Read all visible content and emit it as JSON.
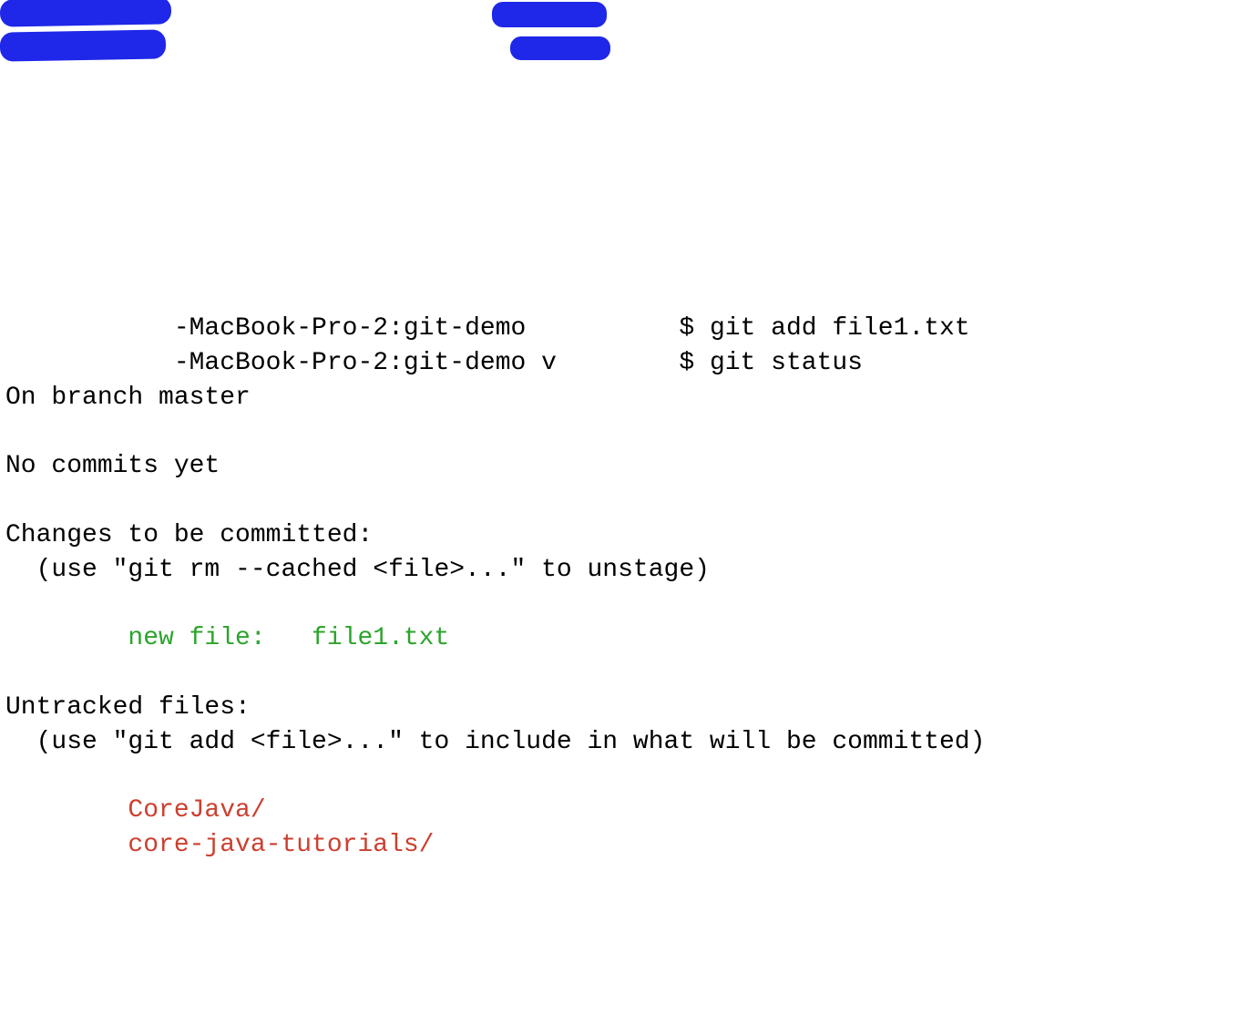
{
  "terminal": {
    "line1": {
      "prompt_prefix": "           -MacBook-Pro-2:git-demo ",
      "prompt_mid": "         ",
      "prompt_suffix": "$ ",
      "command": "git add file1.txt"
    },
    "line2": {
      "prompt_prefix": "           -MacBook-Pro-2:git-demo v",
      "prompt_mid": "        ",
      "prompt_suffix": "$ ",
      "command": "git status"
    },
    "status": {
      "branch": "On branch master",
      "no_commits": "No commits yet",
      "changes_header": "Changes to be committed:",
      "changes_hint": "  (use \"git rm --cached <file>...\" to unstage)",
      "staged_file": "        new file:   file1.txt",
      "untracked_header": "Untracked files:",
      "untracked_hint": "  (use \"git add <file>...\" to include in what will be committed)",
      "untracked1": "        CoreJava/",
      "untracked2": "        core-java-tutorials/"
    }
  }
}
